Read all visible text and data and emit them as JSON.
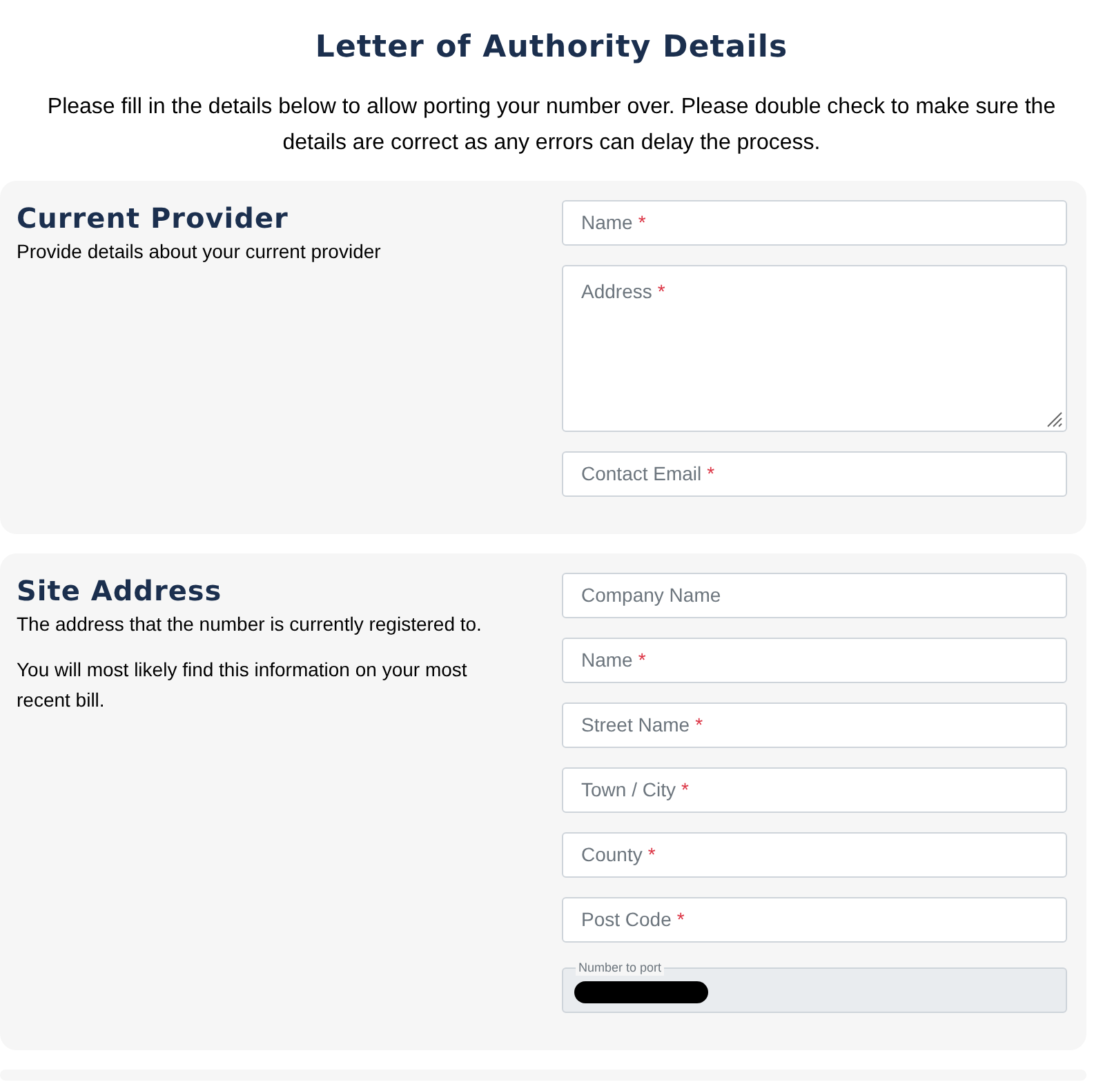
{
  "title": "Letter of Authority Details",
  "intro": "Please fill in the details below to allow porting your number over. Please double check to make sure the details are correct as any errors can delay the process.",
  "sections": [
    {
      "heading": "Current Provider",
      "descriptions": [
        "Provide details about your current provider"
      ],
      "fields": [
        {
          "kind": "input",
          "placeholder": "Name",
          "required_mark": "*"
        },
        {
          "kind": "textarea",
          "placeholder": "Address",
          "required_mark": "*"
        },
        {
          "kind": "input",
          "placeholder": "Contact Email",
          "required_mark": "*"
        }
      ]
    },
    {
      "heading": "Site Address",
      "descriptions": [
        "The address that the number is currently registered to.",
        "You will most likely find this information on your most recent bill."
      ],
      "fields": [
        {
          "kind": "input",
          "placeholder": "Company Name"
        },
        {
          "kind": "input",
          "placeholder": "Name",
          "required_mark": "*"
        },
        {
          "kind": "input",
          "placeholder": "Street Name",
          "required_mark": "*"
        },
        {
          "kind": "input",
          "placeholder": "Town / City",
          "required_mark": "*"
        },
        {
          "kind": "input",
          "placeholder": "County",
          "required_mark": "*"
        },
        {
          "kind": "input",
          "placeholder": "Post Code",
          "required_mark": "*"
        },
        {
          "kind": "locked",
          "label": "Number to port",
          "redacted": true
        }
      ]
    }
  ]
}
